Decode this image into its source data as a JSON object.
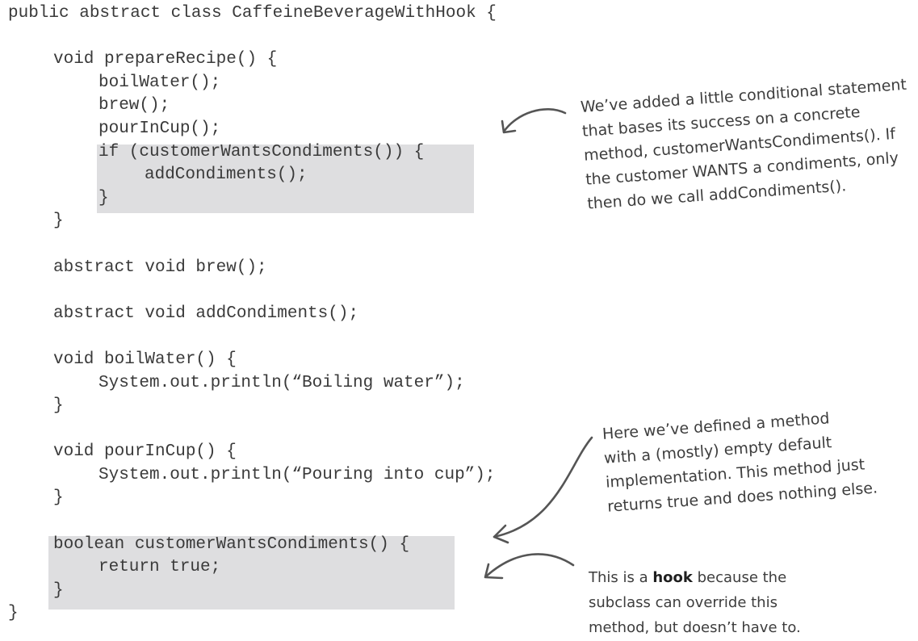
{
  "code_lines": [
    "public abstract class CaffeineBeverageWithHook {",
    "void prepareRecipe() {",
    "boilWater();",
    "brew();",
    "pourInCup();",
    "if (customerWantsCondiments()) {",
    "addCondiments();",
    "}",
    "}",
    "abstract void brew();",
    "abstract void addCondiments();",
    "void boilWater() {",
    "System.out.println(“Boiling water”);",
    "}",
    "void pourInCup() {",
    "System.out.println(“Pouring into cup”);",
    "}",
    "boolean customerWantsCondiments() {",
    "return true;",
    "}",
    "}"
  ],
  "annotations": {
    "conditional": [
      "We’ve added a little conditional statement",
      "that bases its success on a concrete",
      "method, customerWantsCondiments().  If",
      "the customer WANTS a condiments, only",
      "then do we call addCondiments()."
    ],
    "default_impl": [
      "Here we’ve defined a method",
      "with a (mostly) empty default",
      "implementation.  This method just",
      "returns true and does nothing else."
    ],
    "hook": {
      "line1_before": "This is a ",
      "line1_bold": "hook",
      "line1_after": " because the",
      "line2": "subclass can override this",
      "line3": "method, but doesn’t have to."
    }
  },
  "colors": {
    "code_text": "#3a3a3a",
    "highlight": "#dedee0",
    "annotation_text": "#3d3d3d",
    "arrow": "#555555"
  }
}
